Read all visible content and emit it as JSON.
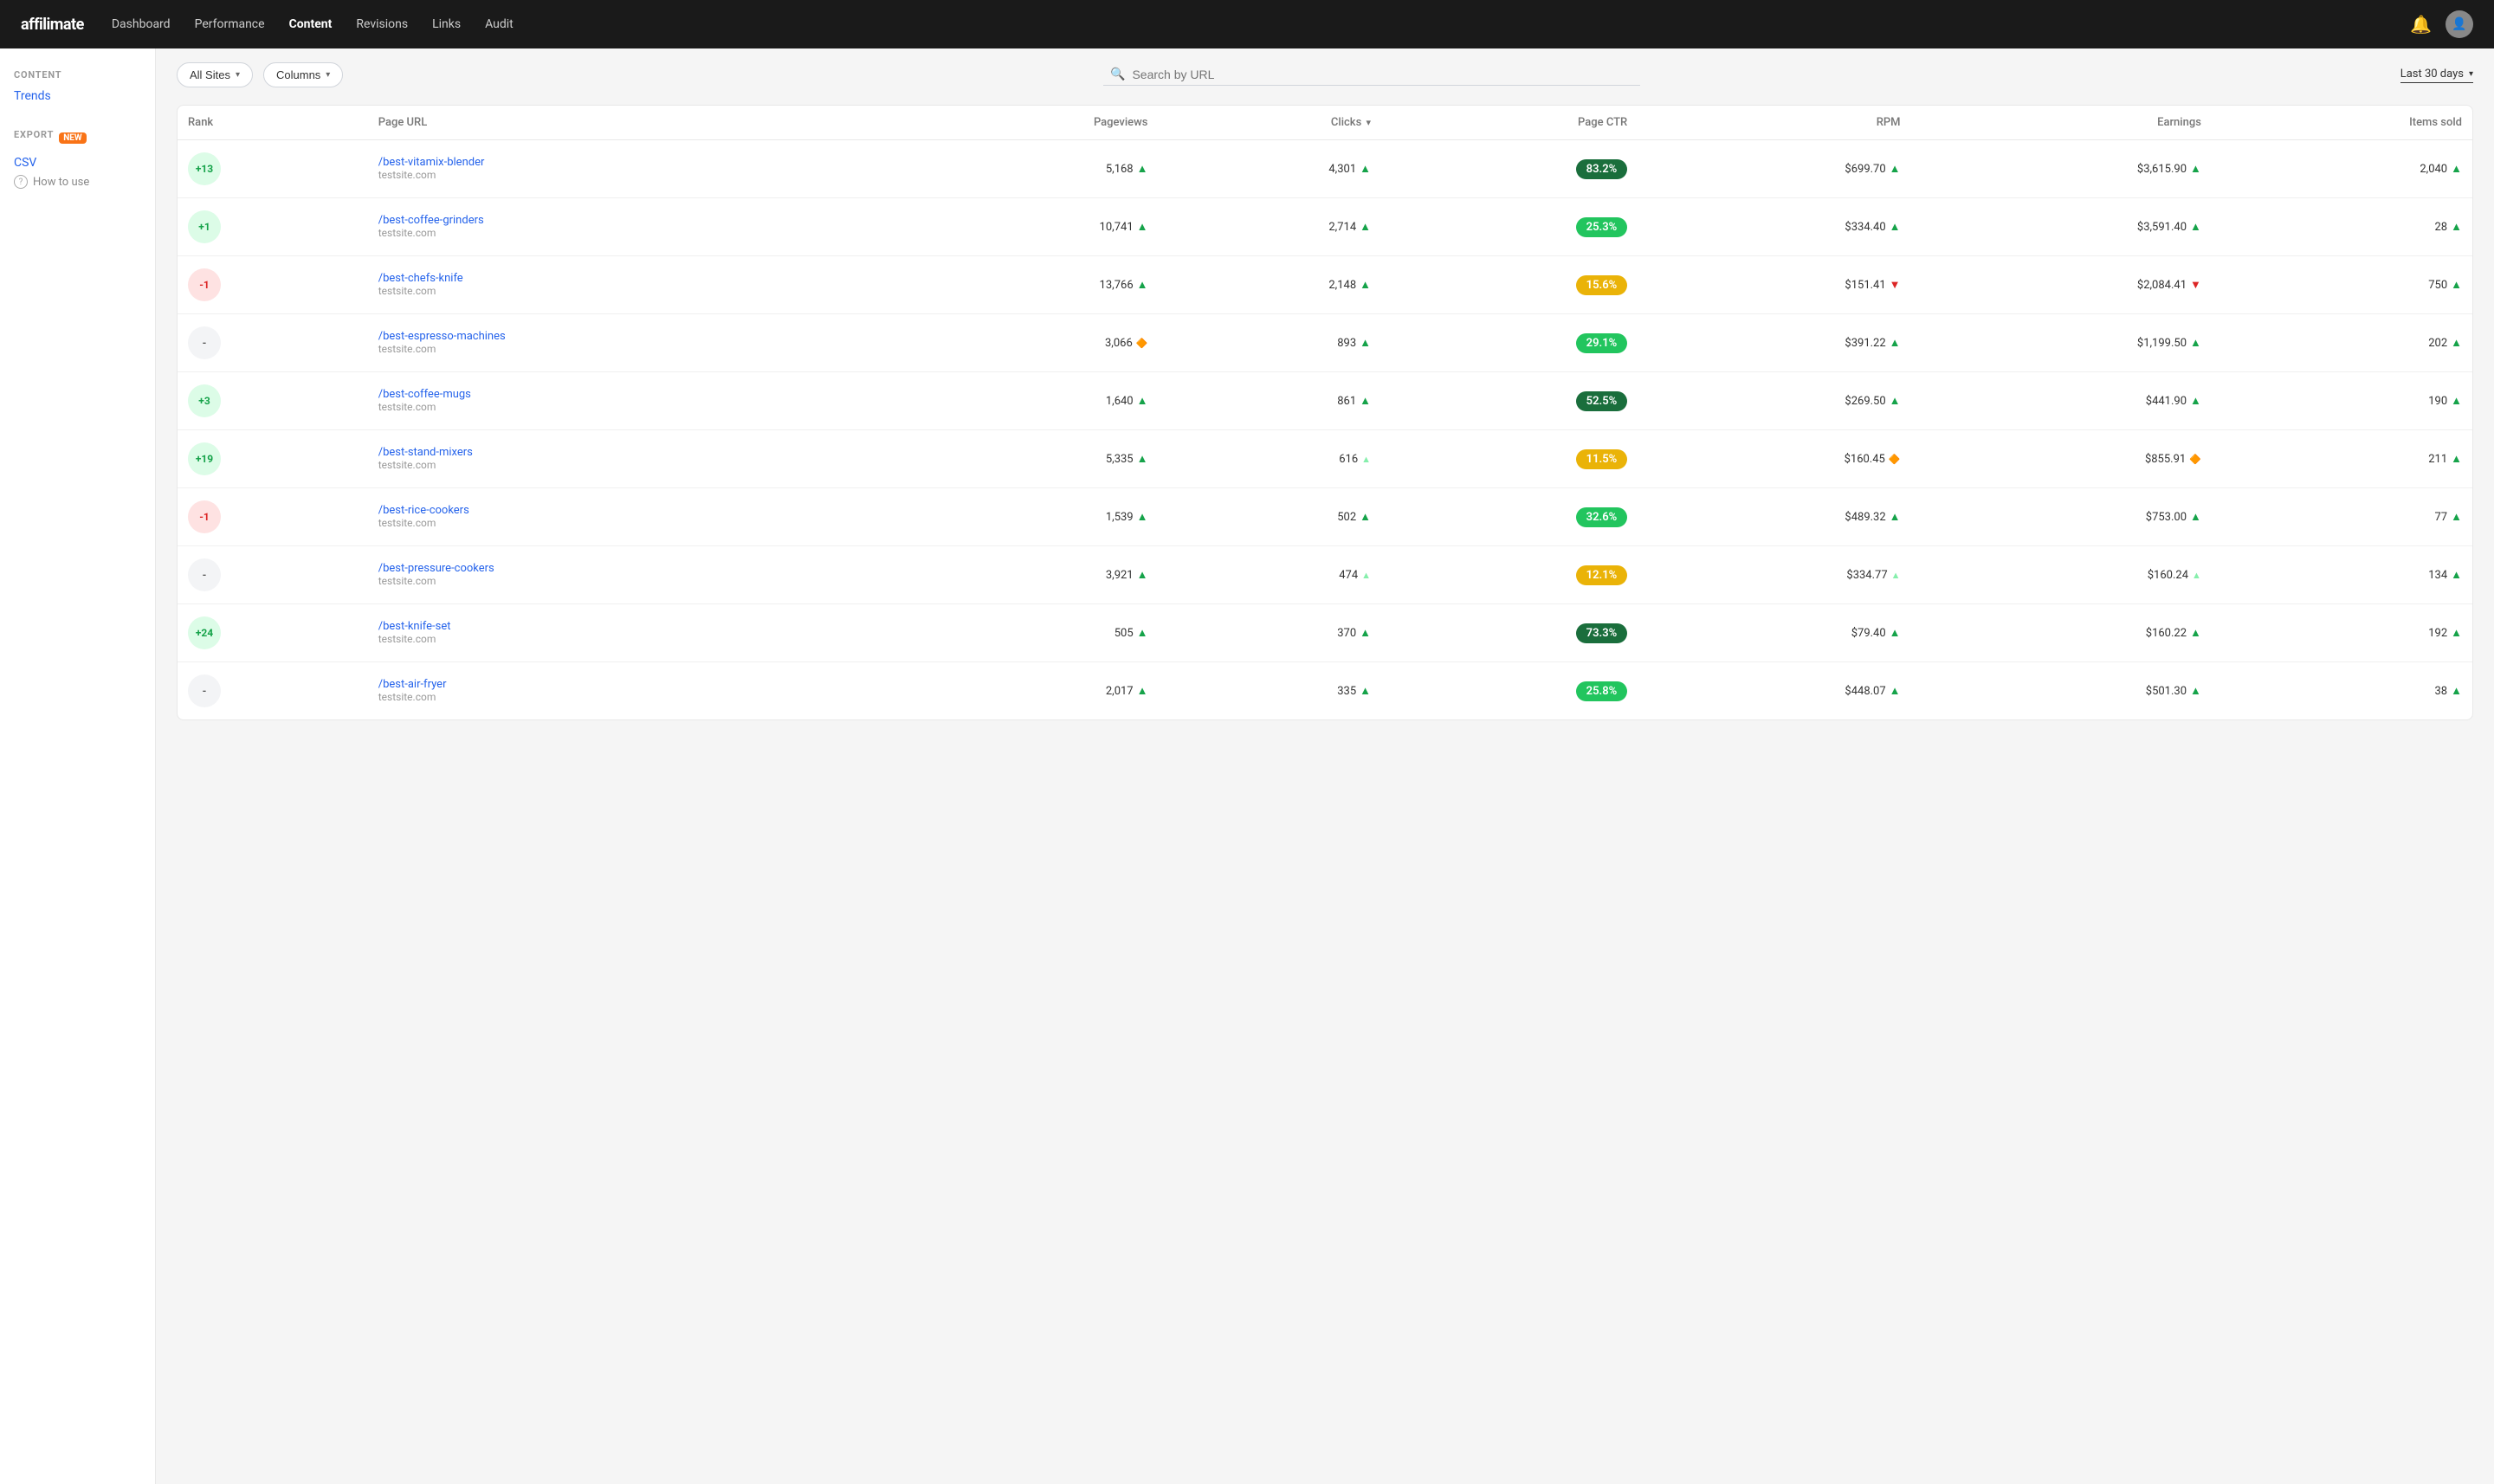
{
  "navbar": {
    "logo": "affilimate",
    "links": [
      "Dashboard",
      "Performance",
      "Content",
      "Revisions",
      "Links",
      "Audit"
    ],
    "active_link": "Content"
  },
  "sidebar": {
    "content_label": "CONTENT",
    "trends_link": "Trends",
    "export_label": "EXPORT",
    "export_badge": "NEW",
    "csv_link": "CSV",
    "how_to_label": "How to use"
  },
  "toolbar": {
    "all_sites_label": "All Sites",
    "columns_label": "Columns",
    "search_placeholder": "Search by URL",
    "date_label": "Last 30 days"
  },
  "table": {
    "headers": [
      "Rank",
      "Page URL",
      "Pageviews",
      "Clicks",
      "Page CTR",
      "RPM",
      "Earnings",
      "Items sold"
    ],
    "rows": [
      {
        "rank": "+13",
        "rank_type": "positive",
        "url": "/best-vitamix-blender",
        "site": "testsite.com",
        "pageviews": "5,168",
        "pageviews_trend": "up",
        "clicks": "4,301",
        "clicks_trend": "up",
        "ctr": "83.2%",
        "ctr_class": "ctr-dark-green",
        "rpm": "$699.70",
        "rpm_trend": "up",
        "earnings": "$3,615.90",
        "earnings_trend": "up",
        "items_sold": "2,040",
        "items_sold_trend": "up"
      },
      {
        "rank": "+1",
        "rank_type": "positive",
        "url": "/best-coffee-grinders",
        "site": "testsite.com",
        "pageviews": "10,741",
        "pageviews_trend": "up",
        "clicks": "2,714",
        "clicks_trend": "up",
        "ctr": "25.3%",
        "ctr_class": "ctr-med-green",
        "rpm": "$334.40",
        "rpm_trend": "up",
        "earnings": "$3,591.40",
        "earnings_trend": "up",
        "items_sold": "28",
        "items_sold_trend": "up"
      },
      {
        "rank": "-1",
        "rank_type": "negative",
        "url": "/best-chefs-knife",
        "site": "testsite.com",
        "pageviews": "13,766",
        "pageviews_trend": "up",
        "clicks": "2,148",
        "clicks_trend": "up",
        "ctr": "15.6%",
        "ctr_class": "ctr-yellow",
        "rpm": "$151.41",
        "rpm_trend": "down",
        "earnings": "$2,084.41",
        "earnings_trend": "down",
        "items_sold": "750",
        "items_sold_trend": "up"
      },
      {
        "rank": "-",
        "rank_type": "neutral",
        "url": "/best-espresso-machines",
        "site": "testsite.com",
        "pageviews": "3,066",
        "pageviews_trend": "flat",
        "clicks": "893",
        "clicks_trend": "up",
        "ctr": "29.1%",
        "ctr_class": "ctr-med-green",
        "rpm": "$391.22",
        "rpm_trend": "up",
        "earnings": "$1,199.50",
        "earnings_trend": "up",
        "items_sold": "202",
        "items_sold_trend": "up"
      },
      {
        "rank": "+3",
        "rank_type": "positive",
        "url": "/best-coffee-mugs",
        "site": "testsite.com",
        "pageviews": "1,640",
        "pageviews_trend": "up",
        "clicks": "861",
        "clicks_trend": "up",
        "ctr": "52.5%",
        "ctr_class": "ctr-dark-green",
        "rpm": "$269.50",
        "rpm_trend": "up",
        "earnings": "$441.90",
        "earnings_trend": "up",
        "items_sold": "190",
        "items_sold_trend": "up"
      },
      {
        "rank": "+19",
        "rank_type": "positive",
        "url": "/best-stand-mixers",
        "site": "testsite.com",
        "pageviews": "5,335",
        "pageviews_trend": "up",
        "clicks": "616",
        "clicks_trend": "flat2",
        "ctr": "11.5%",
        "ctr_class": "ctr-yellow",
        "rpm": "$160.45",
        "rpm_trend": "flat",
        "earnings": "$855.91",
        "earnings_trend": "flat",
        "items_sold": "211",
        "items_sold_trend": "up"
      },
      {
        "rank": "-1",
        "rank_type": "negative",
        "url": "/best-rice-cookers",
        "site": "testsite.com",
        "pageviews": "1,539",
        "pageviews_trend": "up",
        "clicks": "502",
        "clicks_trend": "up",
        "ctr": "32.6%",
        "ctr_class": "ctr-med-green",
        "rpm": "$489.32",
        "rpm_trend": "up",
        "earnings": "$753.00",
        "earnings_trend": "up",
        "items_sold": "77",
        "items_sold_trend": "up"
      },
      {
        "rank": "-",
        "rank_type": "neutral",
        "url": "/best-pressure-cookers",
        "site": "testsite.com",
        "pageviews": "3,921",
        "pageviews_trend": "up",
        "clicks": "474",
        "clicks_trend": "flat2",
        "ctr": "12.1%",
        "ctr_class": "ctr-yellow",
        "rpm": "$334.77",
        "rpm_trend": "flat2",
        "earnings": "$160.24",
        "earnings_trend": "flat2",
        "items_sold": "134",
        "items_sold_trend": "up"
      },
      {
        "rank": "+24",
        "rank_type": "positive",
        "url": "/best-knife-set",
        "site": "testsite.com",
        "pageviews": "505",
        "pageviews_trend": "up",
        "clicks": "370",
        "clicks_trend": "up",
        "ctr": "73.3%",
        "ctr_class": "ctr-dark-green",
        "rpm": "$79.40",
        "rpm_trend": "up",
        "earnings": "$160.22",
        "earnings_trend": "up",
        "items_sold": "192",
        "items_sold_trend": "up"
      },
      {
        "rank": "-",
        "rank_type": "neutral",
        "url": "/best-air-fryer",
        "site": "testsite.com",
        "pageviews": "2,017",
        "pageviews_trend": "up",
        "clicks": "335",
        "clicks_trend": "up",
        "ctr": "25.8%",
        "ctr_class": "ctr-med-green",
        "rpm": "$448.07",
        "rpm_trend": "up",
        "earnings": "$501.30",
        "earnings_trend": "up",
        "items_sold": "38",
        "items_sold_trend": "up"
      }
    ]
  }
}
